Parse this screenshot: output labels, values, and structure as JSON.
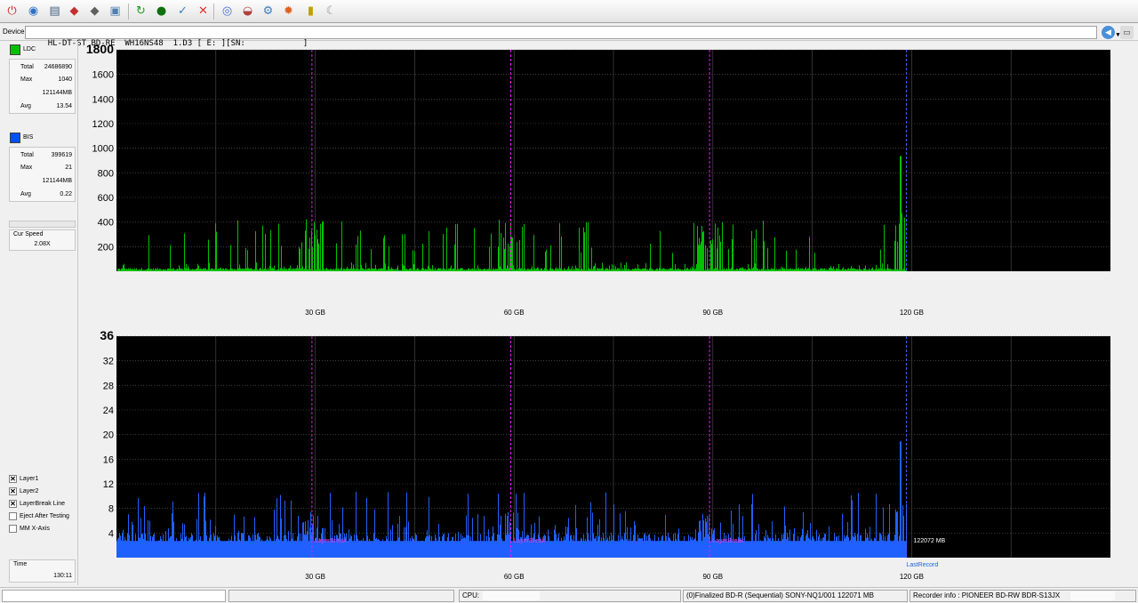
{
  "toolbar": {
    "buttons": [
      "power-icon",
      "disc-info-icon",
      "computer-icon",
      "erase-icon",
      "eraser-icon",
      "copy-disc-icon",
      "refresh-icon",
      "burn-icon",
      "disc-check-icon",
      "stop-icon",
      "disc-quality-icon",
      "scan-icon",
      "settings-icon",
      "fire-icon",
      "chart-icon",
      "sleep-icon"
    ]
  },
  "device": {
    "label": "Device:",
    "value": "HL-DT-ST BD-RE  WH16NS48  1.D3 [ E: ][SN:            ]"
  },
  "sidebar": {
    "ldc": {
      "name": "LDC",
      "color": "#00c000",
      "total_label": "Total",
      "total": "24686890",
      "max_label": "Max",
      "max": "1040",
      "max_pos": "121144MB",
      "avg_label": "Avg",
      "avg": "13.54"
    },
    "bis": {
      "name": "BIS",
      "color": "#0050ff",
      "total_label": "Total",
      "total": "399619",
      "max_label": "Max",
      "max": "21",
      "max_pos": "121144MB",
      "avg_label": "Avg",
      "avg": "0.22"
    },
    "cur_speed_label": "Cur Speed",
    "cur_speed": "2.08X",
    "checks": [
      {
        "label": "Layer1",
        "checked": true
      },
      {
        "label": "Layer2",
        "checked": true
      },
      {
        "label": "LayerBreak Line",
        "checked": true
      },
      {
        "label": "Eject After Testing",
        "checked": false
      },
      {
        "label": "MM X-Axis",
        "checked": false
      }
    ],
    "time_label": "Time",
    "time": "130:11"
  },
  "chart_data": [
    {
      "type": "bar",
      "title": "LDC",
      "color": "#00c000",
      "ylim": [
        0,
        2000
      ],
      "yticks": [
        "200",
        "400",
        "600",
        "800",
        "1000",
        "1200",
        "1400",
        "1600",
        "1800"
      ],
      "xlim": [
        0,
        150
      ],
      "xticks": [
        "30 GB",
        "60 GB",
        "90 GB",
        "120 GB"
      ],
      "layer_breaks": [
        29.5,
        59.5,
        89.5
      ],
      "last_record_gb": 119.2,
      "baseline": 20,
      "typical_peak": 400,
      "max_peak": 1040,
      "max_peak_at_gb": 118.3,
      "grid": true
    },
    {
      "type": "bar",
      "title": "BIS",
      "color": "#2060ff",
      "ylim": [
        0,
        40
      ],
      "yticks": [
        "4",
        "8",
        "12",
        "16",
        "20",
        "24",
        "28",
        "32",
        "36"
      ],
      "xlim": [
        0,
        150
      ],
      "xticks": [
        "30 GB",
        "60 GB",
        "90 GB",
        "120 GB"
      ],
      "layer_breaks": [
        29.5,
        59.5,
        89.5
      ],
      "layerbreak_label": "LayerBreak",
      "last_record_gb": 119.2,
      "last_record_label": "LastRecord",
      "end_label": "122072 MB",
      "baseline": 3,
      "typical_peak": 7,
      "max_peak": 21,
      "max_peak_at_gb": 118.3,
      "grid": true
    }
  ],
  "status": {
    "cpu_label": "CPU:",
    "disc": "(0)Finalized  BD-R (Sequential)  SONY-NQ1/001  122071 MB",
    "recorder": "Recorder info : PIONEER     BD-RW  BDR-S13JX"
  }
}
